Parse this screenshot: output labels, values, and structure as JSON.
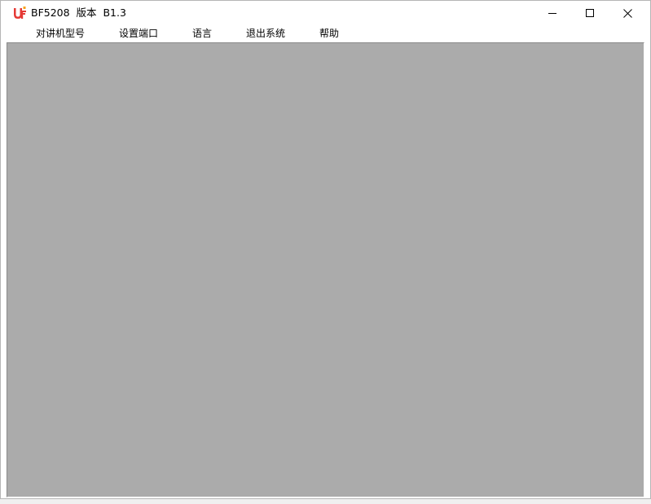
{
  "window": {
    "title": "BF5208  版本  B1.3",
    "app_icon": "uf-logo-icon",
    "controls": {
      "minimize_icon": "minimize-icon",
      "maximize_icon": "maximize-icon",
      "close_icon": "close-icon"
    }
  },
  "menubar": {
    "items": [
      {
        "label": "对讲机型号"
      },
      {
        "label": "设置端口"
      },
      {
        "label": "语言"
      },
      {
        "label": "退出系统"
      },
      {
        "label": "帮助"
      }
    ]
  },
  "colors": {
    "client_background": "#ababab",
    "logo_red": "#e53935",
    "titlebar": "#ffffff"
  }
}
